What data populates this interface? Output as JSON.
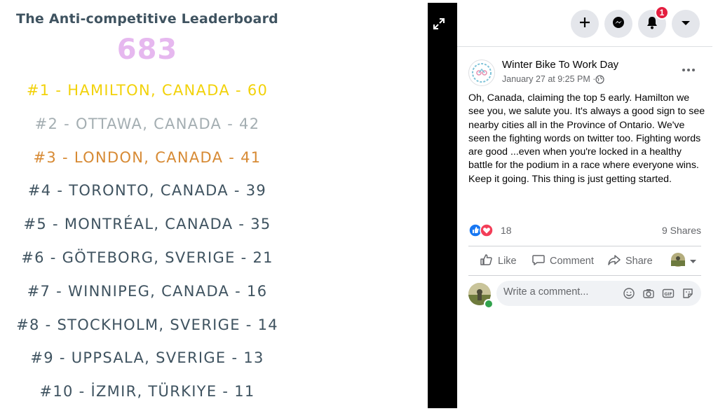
{
  "leaderboard": {
    "title": "The Anti-competitive Leaderboard",
    "total": "683",
    "rows": [
      {
        "text": "#1 - HAMILTON, CANADA - 60",
        "tier": "gold"
      },
      {
        "text": "#2 - OTTAWA, CANADA - 42",
        "tier": "silver"
      },
      {
        "text": "#3 - LONDON, CANADA - 41",
        "tier": "bronze"
      },
      {
        "text": "#4 - TORONTO, CANADA - 39",
        "tier": "normal"
      },
      {
        "text": "#5 - MONTRÉAL, CANADA - 35",
        "tier": "normal"
      },
      {
        "text": "#6 - GÖTEBORG, SVERIGE - 21",
        "tier": "normal"
      },
      {
        "text": "#7 - WINNIPEG, CANADA - 16",
        "tier": "normal"
      },
      {
        "text": "#8 - STOCKHOLM, SVERIGE - 14",
        "tier": "normal"
      },
      {
        "text": "#9 - UPPSALA, SVERIGE - 13",
        "tier": "normal"
      },
      {
        "text": "#10 - İZMIR, TÜRKIYE - 11",
        "tier": "normal"
      }
    ],
    "colors": {
      "gold": "#f2d20a",
      "silver": "#a4aeb2",
      "bronze": "#d78a34",
      "normal": "#3f5360",
      "total": "#e6b8ef"
    }
  },
  "top_bar": {
    "buttons": [
      "create-icon",
      "messenger-icon",
      "notifications-icon",
      "account-menu-icon"
    ],
    "notification_count": "1"
  },
  "post": {
    "page_name": "Winter Bike To Work Day",
    "time": "January 27 at 9:25 PM ·",
    "audience_icon": "globe-icon",
    "text": "Oh, Canada, claiming the top 5 early. Hamilton we see you, we salute you. It's always a good sign to see nearby cities all in the Province of Ontario. We've seen the fighting words on twitter too. Fighting words are good ...even when you're locked in a healthy battle for the podium in a race where everyone wins. Keep it going. This thing is just getting started.",
    "reaction_count": "18",
    "shares": "9 Shares",
    "actions": {
      "like": "Like",
      "comment": "Comment",
      "share": "Share"
    },
    "comment_placeholder": "Write a comment...",
    "comment_icons": [
      "emoji-icon",
      "camera-icon",
      "gif-icon",
      "sticker-icon"
    ]
  },
  "colors": {
    "facebook_blue": "#1877f2",
    "love_red": "#f33e58",
    "muted": "#65676b"
  }
}
